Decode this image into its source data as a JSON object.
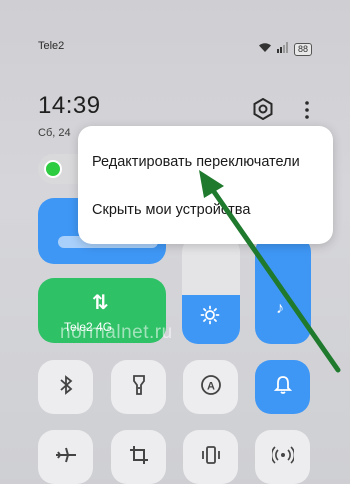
{
  "status_bar": {
    "carrier": "Tele2",
    "battery": "88"
  },
  "header": {
    "time": "14:39",
    "date": "Сб, 24"
  },
  "menu": {
    "items": [
      {
        "label": "Редактировать переключатели"
      },
      {
        "label": "Скрыть мои устройства"
      }
    ]
  },
  "tiles": {
    "mobile_data_label": "Tele2 4G",
    "mobile_data_icon": "⇅",
    "brightness_level": 0.45
  },
  "watermark": "normalnet.ru",
  "colors": {
    "accent_blue": "#3f97f5",
    "accent_green": "#2fc166",
    "arrow_green": "#1f7a2e"
  },
  "icons": [
    "wifi-icon",
    "signal-icon",
    "battery-icon",
    "gear-icon",
    "more-icon",
    "bluetooth-icon",
    "flashlight-icon",
    "auto-brightness-icon",
    "bell-icon",
    "airplane-icon",
    "crop-icon",
    "vibrate-icon",
    "hotspot-icon",
    "sun-icon"
  ]
}
